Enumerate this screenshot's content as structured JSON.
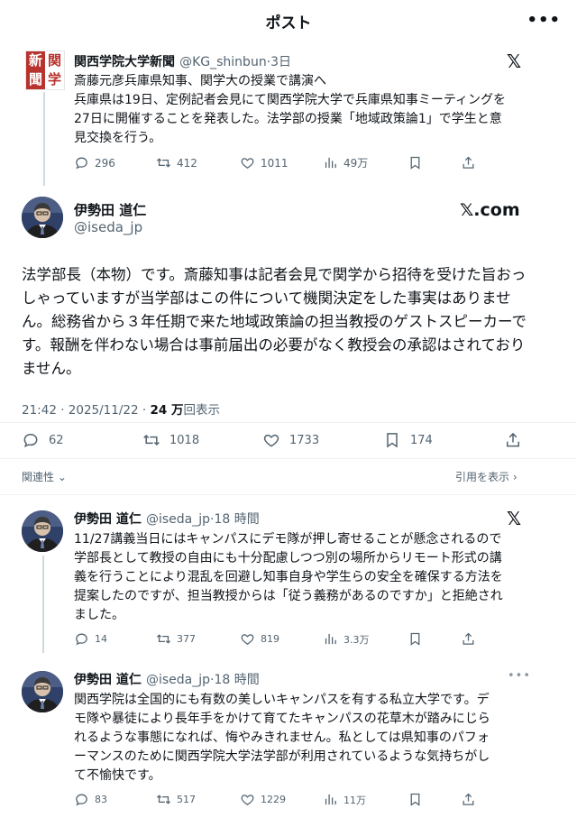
{
  "header": {
    "title": "ポスト"
  },
  "quoted_tweet": {
    "name": "関西学院大学新聞",
    "handle": "@KG_shinbun",
    "time": "3日",
    "avatar_text": [
      "新",
      "関",
      "聞",
      "学"
    ],
    "body": [
      "斎藤元彦兵庫県知事、関学大の授業で講演へ",
      "兵庫県は19日、定例記者会見にて関西学院大学で兵庫県知事ミーティングを",
      "27日に開催することを発表した。法学部の授業「地域政策論1」で学生と意",
      "見交換を行う。"
    ],
    "replies": "296",
    "retweets": "412",
    "likes": "1011",
    "views": "49万"
  },
  "main_tweet": {
    "name": "伊勢田 道仁",
    "handle": "@iseda_jp",
    "source_label": "𝕏.com",
    "body": [
      "法学部長（本物）です。斎藤知事は記者会見で関学から招待を受けた旨おっ",
      "しゃっていますが当学部はこの件について機関決定をした事実はありませ",
      "ん。総務省から３年任期で来た地域政策論の担当教授のゲストスピーカーで",
      "す。報酬を伴わない場合は事前届出の必要がなく教授会の承認はされており",
      "ません。"
    ],
    "timestamp": "21:42 · 2025/11/22 · ",
    "views_count": "24 万",
    "views_label": "回表示",
    "replies": "62",
    "retweets": "1018",
    "likes": "1733",
    "bookmarks": "174"
  },
  "relevance": {
    "sort_label": "関連性",
    "quotes_label": "引用を表示"
  },
  "replies": [
    {
      "name": "伊勢田 道仁",
      "handle": "@iseda_jp",
      "time": "18 時間",
      "body": [
        "11/27講義当日にはキャンパスにデモ隊が押し寄せることが懸念されるので",
        "学部長として教授の自由にも十分配慮しつつ別の場所からリモート形式の講",
        "義を行うことにより混乱を回避し知事自身や学生らの安全を確保する方法を",
        "提案したのですが、担当教授からは「従う義務があるのですか」と拒絶され",
        "ました。"
      ],
      "replies": "14",
      "retweets": "377",
      "likes": "819",
      "views": "3.3万"
    },
    {
      "name": "伊勢田 道仁",
      "handle": "@iseda_jp",
      "time": "18 時間",
      "body": [
        "関西学院は全国的にも有数の美しいキャンパスを有する私立大学です。デ",
        "モ隊や暴徒により長年手をかけて育てたキャンパスの花草木が踏みにじら",
        "れるような事態になれば、悔やみきれません。私としては県知事のパフォ",
        "ーマンスのために関西学院大学法学部が利用されているような気持ちがし",
        "て不愉快です。"
      ],
      "replies": "83",
      "retweets": "517",
      "likes": "1229",
      "views": "11万"
    }
  ]
}
